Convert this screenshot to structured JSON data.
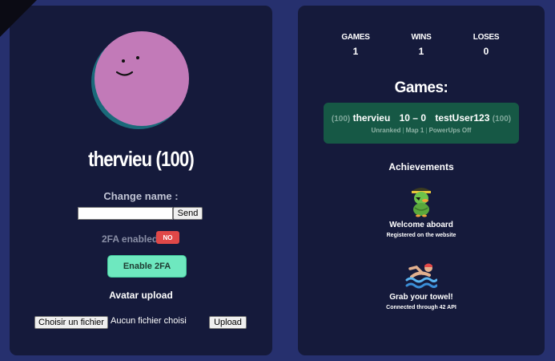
{
  "profile": {
    "username": "thervieu (100)",
    "change_name_label": "Change name :",
    "name_input_value": "",
    "send_label": "Send",
    "twofa_label": "2FA enabled:",
    "twofa_status": "NO",
    "enable_2fa_label": "Enable 2FA",
    "avatar_upload_title": "Avatar upload",
    "choose_file_label": "Choisir un fichier",
    "no_file_label": "Aucun fichier choisi",
    "upload_label": "Upload"
  },
  "stats": {
    "games_label": "GAMES",
    "games_value": "1",
    "wins_label": "WINS",
    "wins_value": "1",
    "loses_label": "LOSES",
    "loses_value": "0"
  },
  "games_title": "Games:",
  "match": {
    "player1_elo": "(100)",
    "player1": "thervieu",
    "score": "10 – 0",
    "player2": "testUser123",
    "player2_elo": "(100)",
    "mode": "Unranked",
    "map": "Map 1",
    "powerups": "PowerUps Off"
  },
  "achievements": {
    "title": "Achievements",
    "items": [
      {
        "name": "Welcome aboard",
        "description": "Registered on the website",
        "icon": "pirate-duck-icon"
      },
      {
        "name": "Grab your towel!",
        "description": "Connected through 42 API",
        "icon": "swimmer-icon"
      }
    ]
  },
  "colors": {
    "background": "#26306e",
    "panel": "#151a3b",
    "avatar": "#c27ab8",
    "accent_green": "#6ee8bf",
    "match_card": "#165845",
    "badge_red": "#e04848"
  }
}
